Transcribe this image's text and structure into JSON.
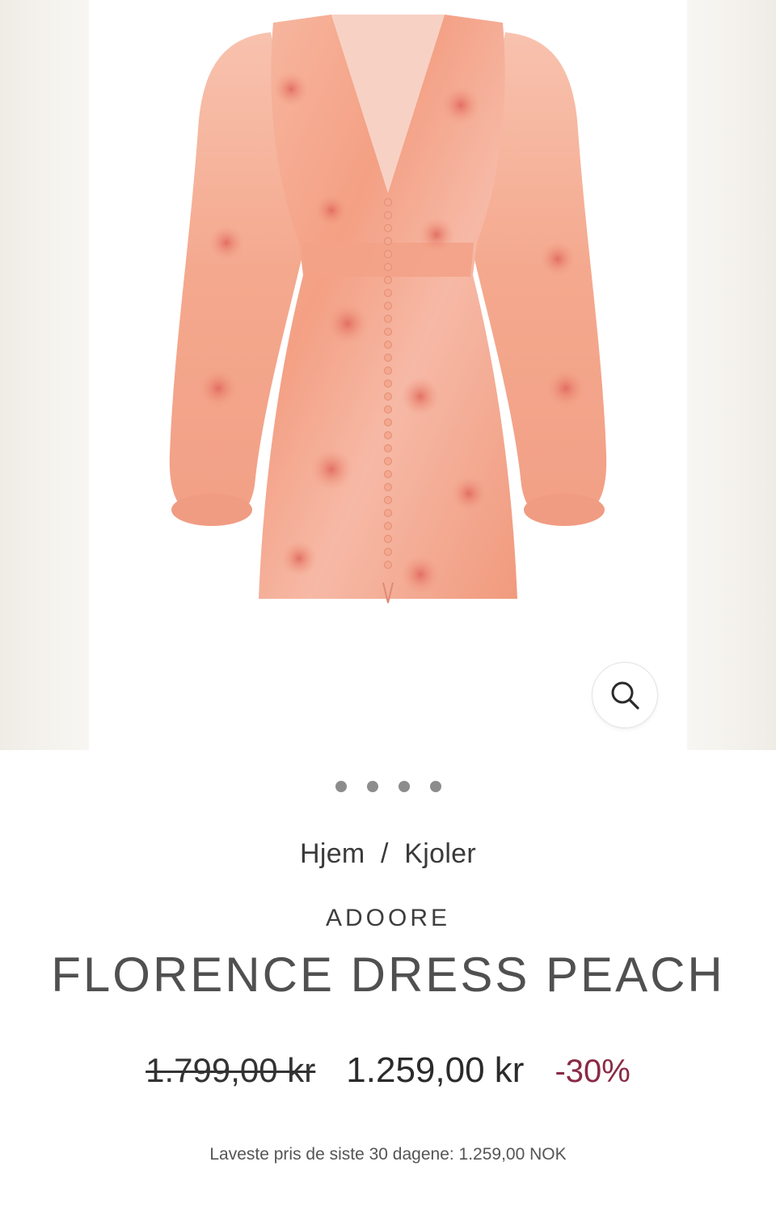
{
  "gallery": {
    "image_alt": "Florence Dress Peach",
    "zoom_icon": "search-icon",
    "dot_count": 4
  },
  "breadcrumb": {
    "home": "Hjem",
    "separator": "/",
    "category": "Kjoler"
  },
  "product": {
    "brand": "ADOORE",
    "title": "FLORENCE DRESS PEACH",
    "old_price": "1.799,00 kr",
    "new_price": "1.259,00 kr",
    "discount": "-30%",
    "lowest_price_note": "Laveste pris de siste 30 dagene: 1.259,00 NOK"
  },
  "colors": {
    "discount": "#8a2a45",
    "dress": "#f4a98c"
  }
}
